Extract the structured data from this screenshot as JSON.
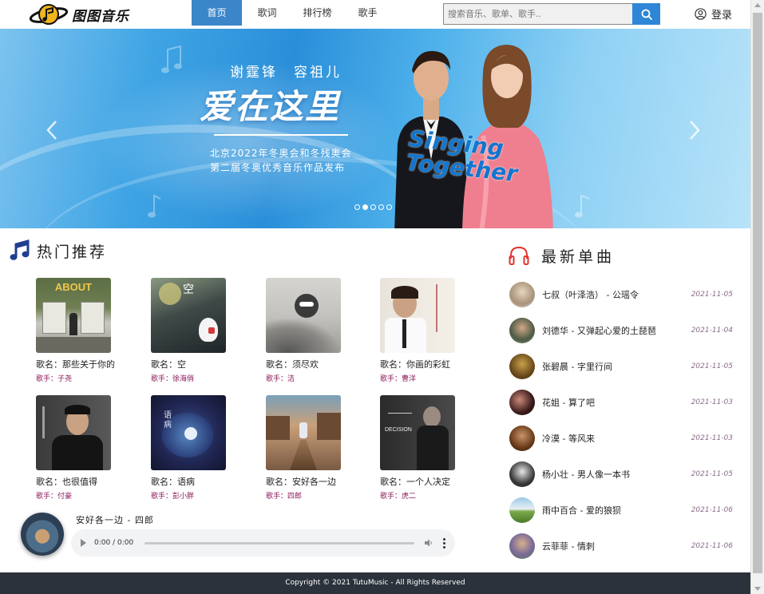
{
  "header": {
    "logo_text": "图图音乐",
    "nav": [
      {
        "label": "首页",
        "active": true
      },
      {
        "label": "歌词",
        "active": false
      },
      {
        "label": "排行榜",
        "active": false
      },
      {
        "label": "歌手",
        "active": false
      }
    ],
    "search_placeholder": "搜索音乐、歌单、歌手..",
    "login_label": "登录"
  },
  "banner": {
    "artists": "谢霆锋　容祖儿",
    "title": "爱在这里",
    "subtitle_line1": "北京2022年冬奥会和冬残奥会",
    "subtitle_line2": "第二届冬奥优秀音乐作品发布",
    "logo_text_1": "Singing",
    "logo_text_2": "Together",
    "active_slide": 2,
    "slide_count": 5
  },
  "hot": {
    "title": "热门推荐",
    "cards": [
      {
        "song": "歌名：那些关于你的",
        "singer_prefix": "歌手：",
        "singer": "子尧"
      },
      {
        "song": "歌名：空",
        "singer_prefix": "歌手：",
        "singer": "徐海俏"
      },
      {
        "song": "歌名：须尽欢",
        "singer_prefix": "歌手：",
        "singer": "洁"
      },
      {
        "song": "歌名：你画的彩虹",
        "singer_prefix": "歌手：",
        "singer": "曹洋"
      },
      {
        "song": "歌名：也很值得",
        "singer_prefix": "歌手：",
        "singer": "付豪"
      },
      {
        "song": "歌名：语病",
        "singer_prefix": "歌手：",
        "singer": "彭小胖"
      },
      {
        "song": "歌名：安好各一边",
        "singer_prefix": "歌手：",
        "singer": "四郎"
      },
      {
        "song": "歌名：一个人决定",
        "singer_prefix": "歌手：",
        "singer": "虎二"
      }
    ],
    "cover_texts": {
      "about": "ABOUT",
      "kong": "空",
      "decision": "DECISION",
      "yibing": "语 病"
    }
  },
  "player": {
    "now_playing": "安好各一边 - 四郎",
    "time": "0:00 / 0:00"
  },
  "latest": {
    "title": "最新单曲",
    "items": [
      {
        "label": "七叔（叶泽浩） - 公瑶令",
        "date": "2021-11-05"
      },
      {
        "label": "刘德华 - 又弹起心爱的土琵琶",
        "date": "2021-11-04"
      },
      {
        "label": "张碧晨 - 字里行间",
        "date": "2021-11-05"
      },
      {
        "label": "花姐 - 算了吧",
        "date": "2021-11-03"
      },
      {
        "label": "冷漠 - 等风来",
        "date": "2021-11-03"
      },
      {
        "label": "杨小壮 - 男人像一本书",
        "date": "2021-11-05"
      },
      {
        "label": "雨中百合 - 爱的狼狈",
        "date": "2021-11-06"
      },
      {
        "label": "云菲菲 - 情刺",
        "date": "2021-11-06"
      }
    ]
  },
  "footer": {
    "copyright": "Copyright © 2021 TutuMusic - All Rights Reserved"
  },
  "colors": {
    "nav_active": "#3b86c9",
    "search_button": "#2f86d6",
    "singer_text": "#8b1a5a",
    "footer_bg": "#2c323c"
  }
}
